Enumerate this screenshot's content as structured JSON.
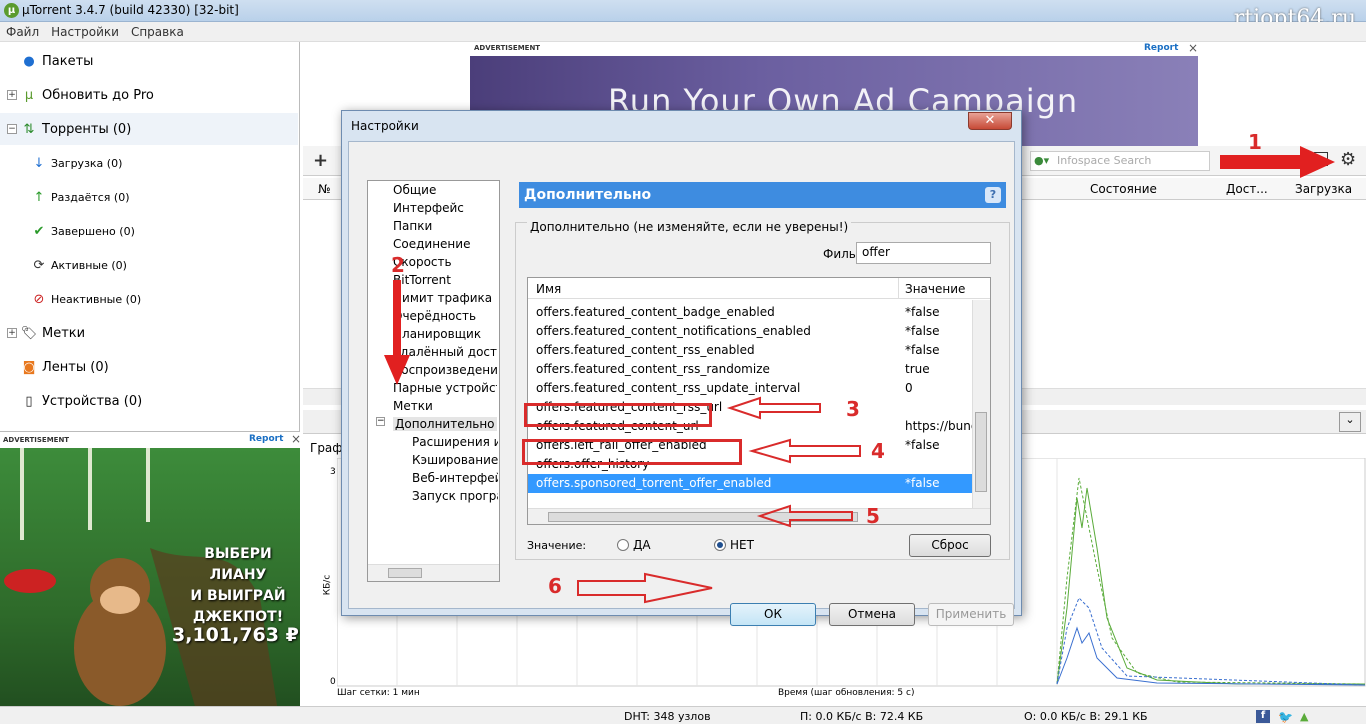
{
  "window": {
    "title": "µTorrent 3.4.7  (build 42330) [32-bit]",
    "watermark": "rtiopt64.ru"
  },
  "menu": [
    "Файл",
    "Настройки",
    "Справка"
  ],
  "sidebar": {
    "items": [
      {
        "label": "Пакеты"
      },
      {
        "label": "Обновить до Pro"
      },
      {
        "label": "Торренты (0)"
      },
      {
        "label": "Загрузка (0)"
      },
      {
        "label": "Раздаётся (0)"
      },
      {
        "label": "Завершено (0)"
      },
      {
        "label": "Активные (0)"
      },
      {
        "label": "Неактивные (0)"
      },
      {
        "label": "Метки"
      },
      {
        "label": "Ленты (0)"
      },
      {
        "label": "Устройства (0)"
      }
    ]
  },
  "ads": {
    "label": "ADVERTISEMENT",
    "report": "Report",
    "top_text": "Run Your Own Ad Campaign",
    "side_text_1": "ВЫБЕРИ ЛИАНУ",
    "side_text_2": "И ВЫИГРАЙ",
    "side_text_3": "ДЖЕКПОТ!",
    "side_jackpot": "3,101,763 ₽"
  },
  "toolbar": {
    "search_placeholder": "Infospace Search"
  },
  "table": {
    "col_no": "№",
    "col_status": "Состояние",
    "col_avail": "Дост...",
    "col_download": "Загрузка"
  },
  "bottom": {
    "tab_graph": "Графи",
    "y_axis": "КБ/с",
    "y_max": "3",
    "y_min": "0",
    "grid_step": "Шаг сетки: 1 мин",
    "time_label": "Время (шаг обновления: 5 с)"
  },
  "dialog": {
    "title": "Настройки",
    "tree": [
      "Общие",
      "Интерфейс",
      "Папки",
      "Соединение",
      "Скорость",
      "BitTorrent",
      "Лимит трафика",
      "Очерёдность",
      "Планировщик",
      "Удалённый доступ",
      "Воспроизведение",
      "Парные устройства",
      "Метки",
      "Дополнительно",
      "Расширения инт",
      "Кэширование",
      "Веб-интерфейс",
      "Запуск программ"
    ],
    "panel_title": "Дополнительно",
    "group_label": "Дополнительно (не изменяйте, если не уверены!)",
    "filter_label": "Фильтр",
    "filter_value": "offer",
    "col_name": "Имя",
    "col_value": "Значение",
    "rows": [
      {
        "name": "offers.featured_content_badge_enabled",
        "value": "*false"
      },
      {
        "name": "offers.featured_content_notifications_enabled",
        "value": "*false"
      },
      {
        "name": "offers.featured_content_rss_enabled",
        "value": "*false"
      },
      {
        "name": "offers.featured_content_rss_randomize",
        "value": "true"
      },
      {
        "name": "offers.featured_content_rss_update_interval",
        "value": "0"
      },
      {
        "name": "offers.featured_content_rss_url",
        "value": ""
      },
      {
        "name": "offers.featured_content_url",
        "value": "https://bund"
      },
      {
        "name": "offers.left_rail_offer_enabled",
        "value": "*false"
      },
      {
        "name": "offers.offer_history",
        "value": ""
      },
      {
        "name": "offers.sponsored_torrent_offer_enabled",
        "value": "*false"
      }
    ],
    "value_label": "Значение:",
    "radio_yes": "ДА",
    "radio_no": "НЕТ",
    "reset": "Сброс",
    "ok": "ОК",
    "cancel": "Отмена",
    "apply": "Применить"
  },
  "annotations": [
    "1",
    "2",
    "3",
    "4",
    "5",
    "6"
  ],
  "status": {
    "dht": "DHT: 348 узлов",
    "down": "П: 0.0 КБ/с В: 72.4 КБ",
    "up": "О: 0.0 КБ/с В: 29.1 КБ"
  },
  "colors": {
    "accent": "#3e8ce0",
    "annotation": "#d92b2b",
    "selection": "#3399ff"
  }
}
